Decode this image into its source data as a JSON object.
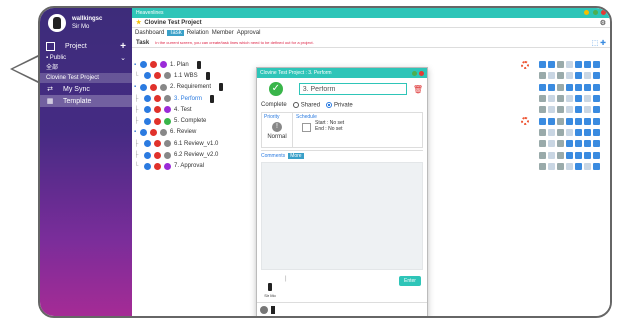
{
  "user": {
    "name": "wallkingsc",
    "sub": "Sir Mo"
  },
  "sidebar": {
    "project_label": "Project",
    "public_label": "Public",
    "items": [
      "全部",
      "Clovine Test Project"
    ],
    "my_sync": "My Sync",
    "template": "Template"
  },
  "window": {
    "title": "Heavenlines"
  },
  "project": {
    "name": "Clovine Test Project"
  },
  "tabs": [
    "Dashboard",
    "Task",
    "Relation",
    "Member",
    "Approval"
  ],
  "subbar": {
    "label": "Task",
    "hint": "In the current screen, you can create/task lines which need to be defined out for a project."
  },
  "tasks": [
    {
      "label": "1. Plan",
      "chip": "c-purple"
    },
    {
      "label": "1.1 WBS",
      "chip": "c-grey"
    },
    {
      "label": "2. Requirement",
      "chip": "c-grey"
    },
    {
      "label": "3. Perform",
      "chip": "c-grey"
    },
    {
      "label": "4. Test",
      "chip": "c-purple"
    },
    {
      "label": "5. Complete",
      "chip": "c-green"
    },
    {
      "label": "6. Review",
      "chip": "c-grey"
    },
    {
      "label": "6.1 Review_v1.0",
      "chip": "c-grey"
    },
    {
      "label": "6.2 Review_v2.0",
      "chip": "c-grey"
    },
    {
      "label": "7. Approval",
      "chip": "c-purple"
    }
  ],
  "modal": {
    "title": "Clovine Test Project : 3. Perform",
    "task_name": "3. Perform",
    "status": "Complete",
    "shared": "Shared",
    "private": "Private",
    "priority_label": "Priority",
    "priority_value": "Normal",
    "schedule_label": "Schedule",
    "start_label": "Start :",
    "start_value": "No set",
    "end_label": "End :",
    "end_value": "No set",
    "comments_label": "Comments",
    "more_label": "More",
    "user_label": "Sir Mo",
    "enter_label": "Enter"
  },
  "colors": {
    "accent": "#2ec5b8",
    "sidebar_top": "#3d2c7a",
    "sidebar_bottom": "#a52b95"
  }
}
